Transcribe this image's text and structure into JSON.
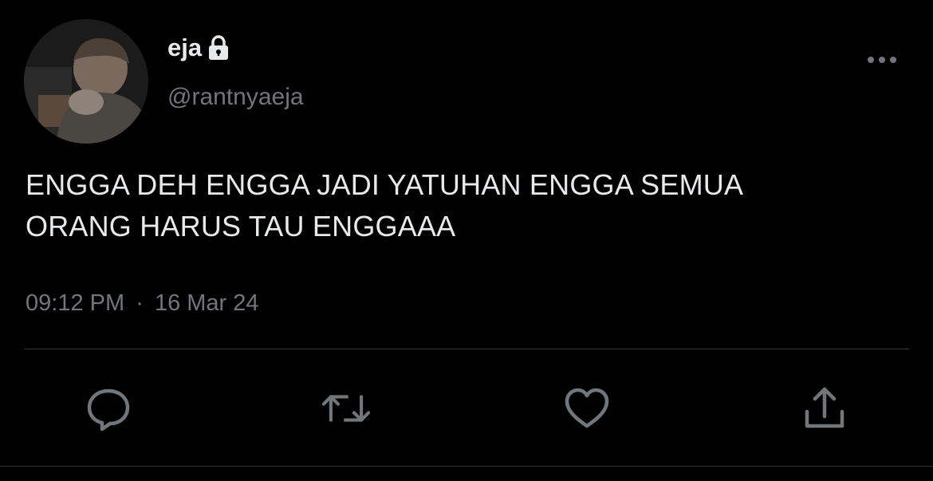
{
  "user": {
    "display_name": "eja",
    "handle": "@rantnyaeja",
    "protected_icon": "lock-icon",
    "avatar": "profile-photo"
  },
  "tweet": {
    "text_line1": "ENGGA DEH ENGGA JADI YATUHAN ENGGA SEMUA",
    "text_line2": "ORANG HARUS TAU ENGGAAA",
    "time": "09:12 PM",
    "separator": "·",
    "date": "16 Mar 24"
  },
  "actions": {
    "icons": [
      "reply-icon",
      "retweet-icon",
      "like-icon",
      "share-icon"
    ]
  },
  "menu": {
    "more_icon": "more-options-icon"
  },
  "colors": {
    "background": "#000000",
    "primary_text": "#e7e9ea",
    "secondary_text": "#71767b",
    "divider": "#2f3336"
  }
}
